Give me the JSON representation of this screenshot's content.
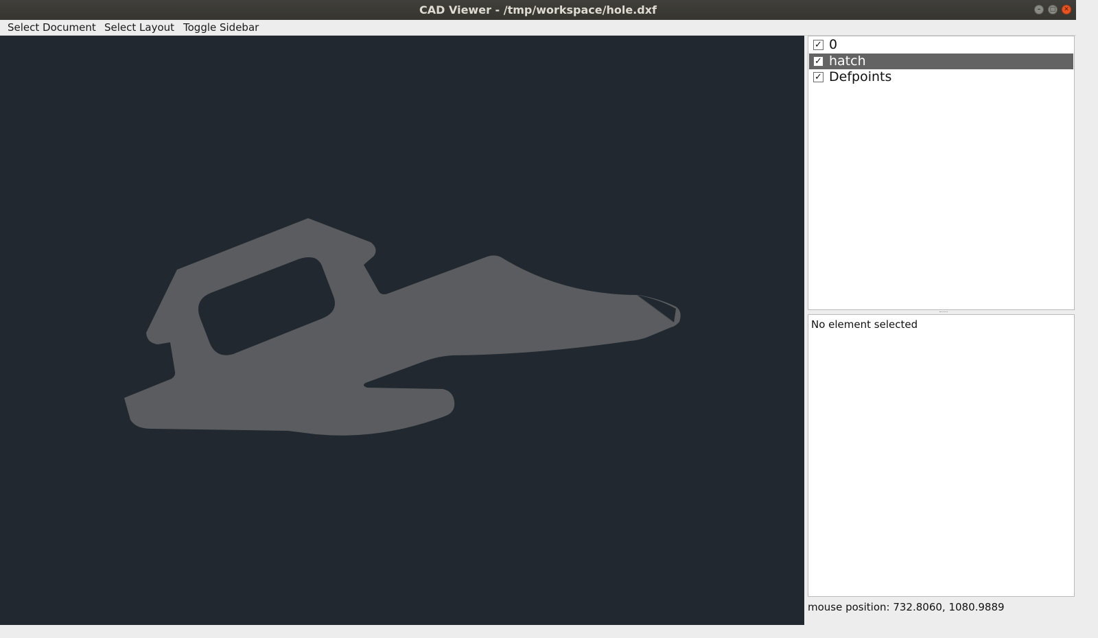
{
  "window": {
    "title": "CAD Viewer - /tmp/workspace/hole.dxf",
    "controls": [
      "minimize-icon",
      "maximize-icon",
      "close-icon"
    ]
  },
  "menu": {
    "select_document": "Select Document",
    "select_layout": "Select Layout",
    "toggle_sidebar": "Toggle Sidebar"
  },
  "layers": [
    {
      "name": "0",
      "visible": true,
      "selected": false
    },
    {
      "name": "hatch",
      "visible": true,
      "selected": true
    },
    {
      "name": "Defpoints",
      "visible": true,
      "selected": false
    }
  ],
  "info": {
    "text": "No element selected"
  },
  "status": {
    "mouse_position": "mouse position: 732.8060, 1080.9889"
  },
  "colors": {
    "canvas_background": "#212830",
    "hatch_fill": "#5a5c5f",
    "selected_row": "#636363"
  }
}
